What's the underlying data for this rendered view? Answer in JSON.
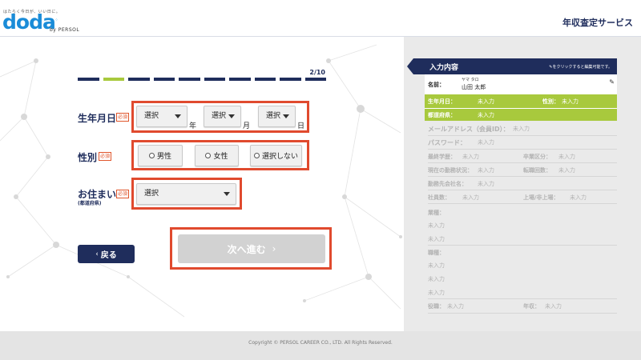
{
  "header": {
    "tagline": "はたらく今日が、いい日に。",
    "logo": "doda",
    "logo_by": "by PERSOL",
    "service_title": "年収査定サービス"
  },
  "progress": {
    "current": 2,
    "total": 10,
    "text": "2/10"
  },
  "form": {
    "birthdate": {
      "label": "生年月日",
      "required": "必須",
      "year_select": "選択",
      "year_unit": "年",
      "month_select": "選択",
      "month_unit": "月",
      "day_select": "選択",
      "day_unit": "日"
    },
    "gender": {
      "label": "性別",
      "required": "必須",
      "options": [
        "男性",
        "女性",
        "選択しない"
      ]
    },
    "residence": {
      "label": "お住まい",
      "sublabel": "(都道府県)",
      "required": "必須",
      "select": "選択"
    },
    "back_label": "戻る",
    "next_label": "次へ進む"
  },
  "panel": {
    "title": "入力内容",
    "edit_note": "をクリックすると編集可能です。",
    "name_label": "名前：",
    "name_kana": "ヤマ タロ",
    "name_value": "山田 太郎",
    "birthdate_label": "生年月日：",
    "birthdate_value": "未入力",
    "gender_label": "性別：",
    "gender_value": "未入力",
    "prefecture_label": "都道府県：",
    "prefecture_value": "未入力",
    "email_label": "メールアドレス（会員ID）：",
    "email_value": "未入力",
    "password_label": "パスワード：",
    "password_value": "未入力",
    "education_label": "最終学歴：",
    "education_value": "未入力",
    "graduation_label": "卒業区分：",
    "graduation_value": "未入力",
    "employment_label": "現在の勤務状況：",
    "employment_value": "未入力",
    "jobchanges_label": "転職回数：",
    "jobchanges_value": "未入力",
    "company_label": "勤務先会社名：",
    "company_value": "未入力",
    "employees_label": "社員数：",
    "employees_value": "未入力",
    "listed_label": "上場/非上場：",
    "listed_value": "未入力",
    "industry_label": "業種：",
    "industry_values": [
      "未入力",
      "未入力"
    ],
    "occupation_label": "職種：",
    "occupation_values": [
      "未入力",
      "未入力",
      "未入力"
    ],
    "position_label": "役職：",
    "position_value": "未入力",
    "income_label": "年収：",
    "income_value": "未入力"
  },
  "footer": {
    "copyright": "Copyright © PERSOL CAREER CO., LTD. All Rights Reserved."
  }
}
